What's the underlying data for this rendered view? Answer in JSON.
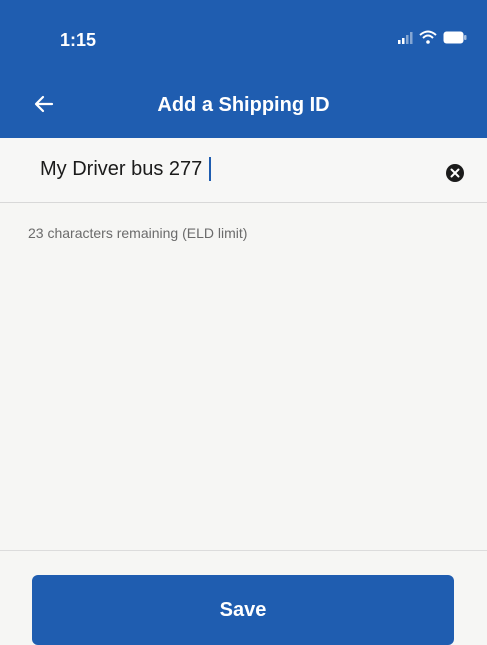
{
  "status_bar": {
    "time": "1:15",
    "icons": [
      "signal-icon",
      "wifi-icon",
      "battery-icon"
    ]
  },
  "header": {
    "title": "Add a Shipping ID",
    "back_icon": "arrow-left-icon"
  },
  "shipping_id_field": {
    "value": "My Driver bus 277",
    "clear_icon": "clear-circle-icon"
  },
  "helper": {
    "text": "23 characters remaining (ELD limit)"
  },
  "footer": {
    "save_label": "Save"
  },
  "colors": {
    "primary": "#1f5db0",
    "background": "#f6f6f4",
    "helper_text": "#6b6b6b"
  }
}
